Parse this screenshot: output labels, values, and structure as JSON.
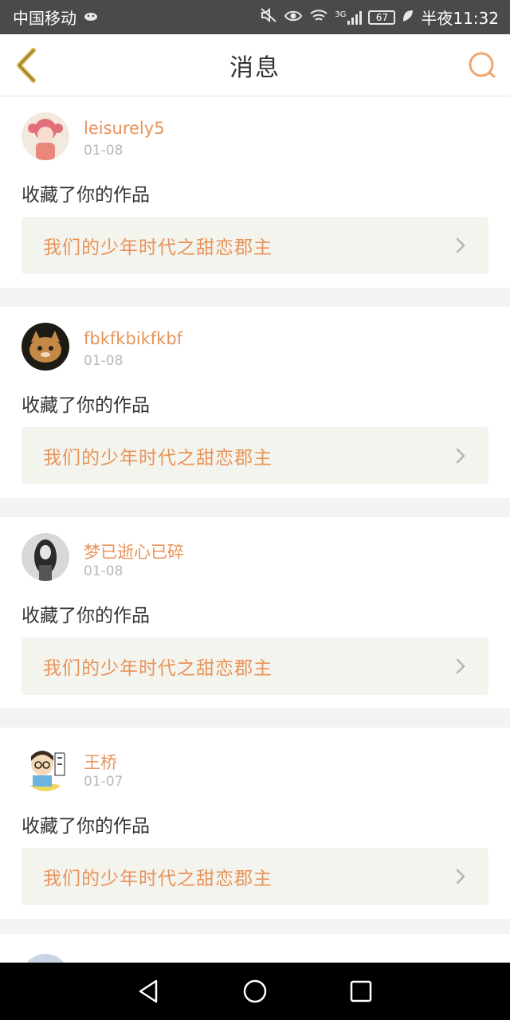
{
  "status_bar": {
    "carrier": "中国移动",
    "battery": "67",
    "time": "半夜11:32",
    "network": "3G"
  },
  "header": {
    "title": "消息"
  },
  "messages": [
    {
      "username": "leisurely5",
      "date": "01-08",
      "action": "收藏了你的作品",
      "work_title": "我们的少年时代之甜恋郡主"
    },
    {
      "username": "fbkfkbikfkbf",
      "date": "01-08",
      "action": "收藏了你的作品",
      "work_title": "我们的少年时代之甜恋郡主"
    },
    {
      "username": "梦已逝心已碎",
      "date": "01-08",
      "action": "收藏了你的作品",
      "work_title": "我们的少年时代之甜恋郡主"
    },
    {
      "username": "王桥",
      "date": "01-07",
      "action": "收藏了你的作品",
      "work_title": "我们的少年时代之甜恋郡主"
    }
  ],
  "colors": {
    "accent": "#e8935a",
    "back_icon": "#d8b44a",
    "card_link_bg": "#f4f4ee"
  }
}
